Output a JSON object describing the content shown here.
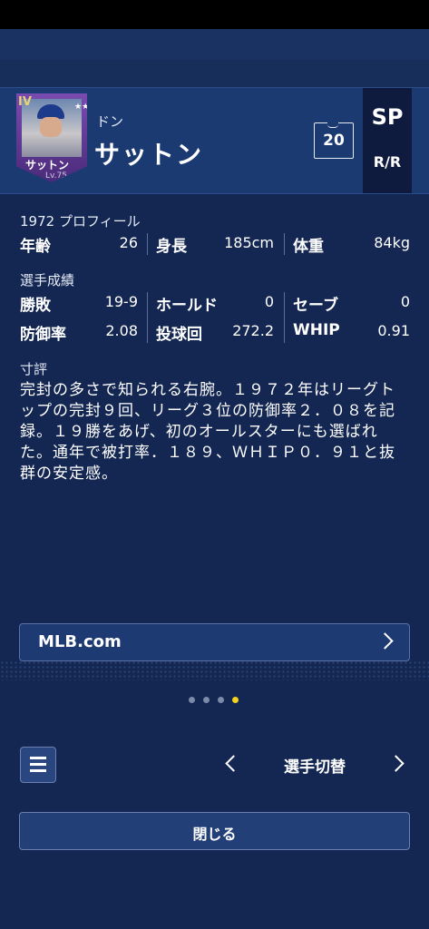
{
  "player": {
    "card_name": "サットン",
    "card_level": "Lv.75",
    "card_grade": "IV",
    "card_stars": "★★★★★★",
    "first_name": "ドン",
    "last_name": "サットン",
    "number": "20",
    "position": "SP",
    "handedness": "R/R"
  },
  "profile": {
    "heading": "1972 プロフィール",
    "age_label": "年齢",
    "age": "26",
    "height_label": "身長",
    "height": "185cm",
    "weight_label": "体重",
    "weight": "84kg"
  },
  "stats": {
    "heading": "選手成績",
    "record_label": "勝敗",
    "record": "19-9",
    "holds_label": "ホールド",
    "holds": "0",
    "saves_label": "セーブ",
    "saves": "0",
    "era_label": "防御率",
    "era": "2.08",
    "ip_label": "投球回",
    "ip": "272.2",
    "whip_label": "WHIP",
    "whip": "0.91"
  },
  "review": {
    "heading": "寸評",
    "text": "完封の多さで知られる右腕。１９７２年はリーグトップの完封９回、リーグ３位の防御率２．０８を記録。１９勝をあげ、初のオールスターにも選ばれた。通年で被打率．１８９、ＷＨＩＰ０．９１と抜群の安定感。"
  },
  "links": {
    "mlb_label": "MLB.com"
  },
  "pager": {
    "total": 4,
    "active_index": 3
  },
  "footer": {
    "switch_label": "選手切替",
    "close_label": "閉じる"
  },
  "colors": {
    "background": "#142752",
    "header": "#1c3a72",
    "pager_active": "#f4d21e"
  }
}
